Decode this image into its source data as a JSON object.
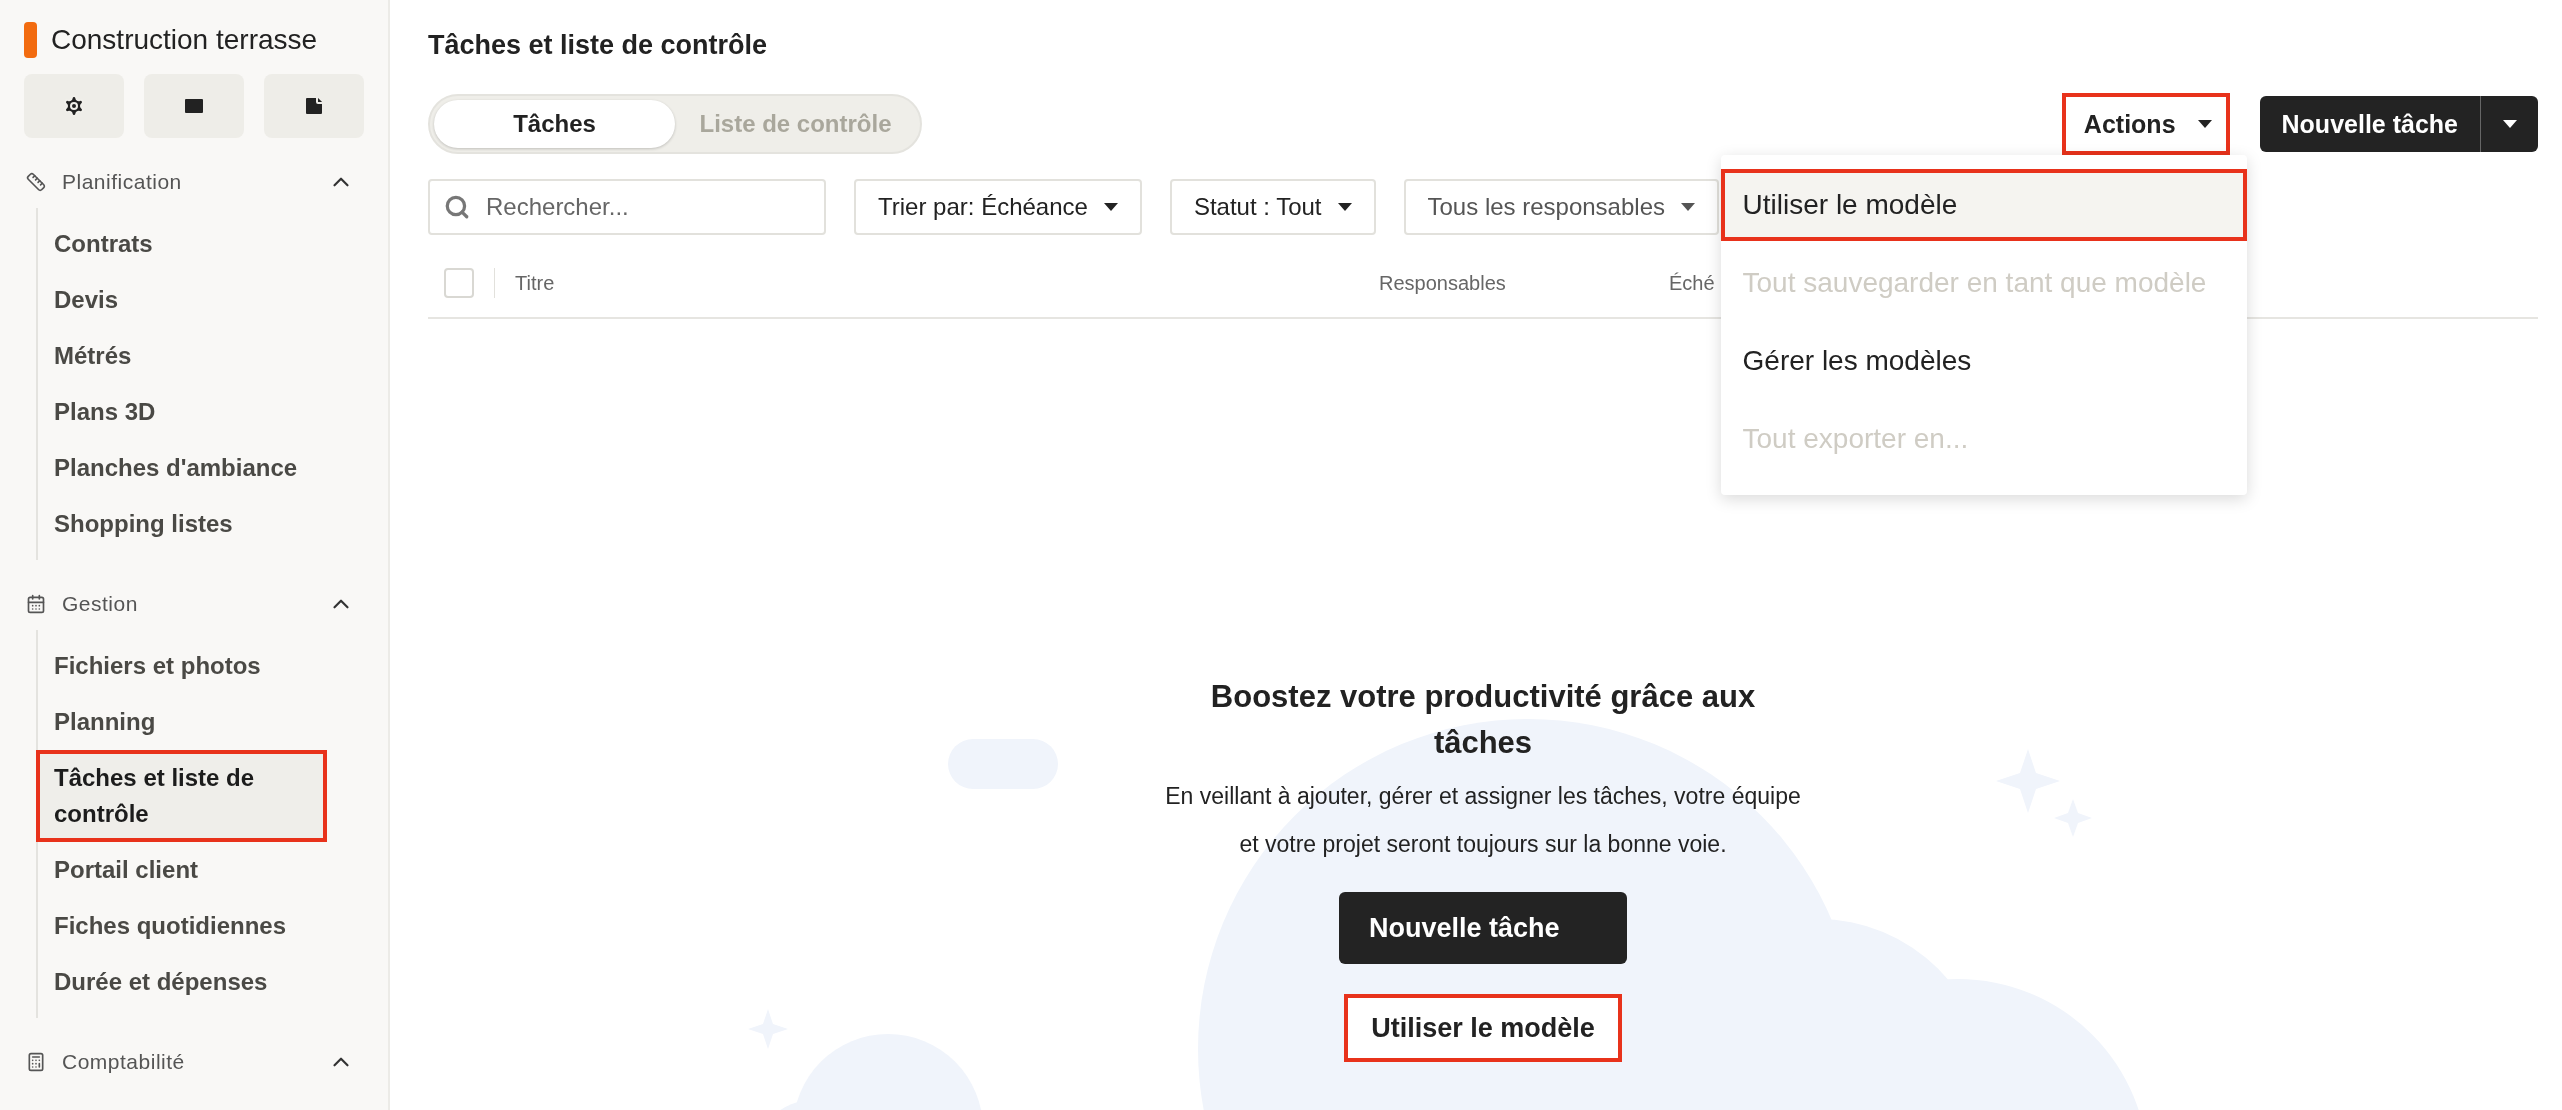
{
  "sidebar": {
    "project_title": "Construction terrasse",
    "sections": [
      {
        "label": "Planification",
        "kind": "planning",
        "expanded": true,
        "items": [
          {
            "label": "Contrats",
            "selected": false,
            "highlighted": false
          },
          {
            "label": "Devis",
            "selected": false,
            "highlighted": false
          },
          {
            "label": "Métrés",
            "selected": false,
            "highlighted": false
          },
          {
            "label": "Plans 3D",
            "selected": false,
            "highlighted": false
          },
          {
            "label": "Planches d'ambiance",
            "selected": false,
            "highlighted": false
          },
          {
            "label": "Shopping listes",
            "selected": false,
            "highlighted": false
          }
        ]
      },
      {
        "label": "Gestion",
        "kind": "calendar",
        "expanded": true,
        "items": [
          {
            "label": "Fichiers et photos",
            "selected": false,
            "highlighted": false
          },
          {
            "label": "Planning",
            "selected": false,
            "highlighted": false
          },
          {
            "label": "Tâches et liste de contrôle",
            "selected": true,
            "highlighted": true
          },
          {
            "label": "Portail client",
            "selected": false,
            "highlighted": false
          },
          {
            "label": "Fiches quotidiennes",
            "selected": false,
            "highlighted": false
          },
          {
            "label": "Durée et dépenses",
            "selected": false,
            "highlighted": false
          }
        ]
      },
      {
        "label": "Comptabilité",
        "kind": "calculator",
        "expanded": true
      }
    ]
  },
  "main": {
    "title": "Tâches et liste de contrôle",
    "tabs": [
      {
        "label": "Tâches",
        "selected": true
      },
      {
        "label": "Liste de contrôle",
        "selected": false
      }
    ],
    "actions_button": {
      "label": "Actions",
      "highlighted": true
    },
    "new_task_button": {
      "label": "Nouvelle tâche"
    },
    "actions_menu": [
      {
        "label": "Utiliser le modèle",
        "disabled": false,
        "highlighted": true
      },
      {
        "label": "Tout sauvegarder en tant que modèle",
        "disabled": true,
        "highlighted": false
      },
      {
        "label": "Gérer les modèles",
        "disabled": false,
        "highlighted": false
      },
      {
        "label": "Tout exporter en...",
        "disabled": true,
        "highlighted": false
      }
    ],
    "search": {
      "placeholder": "Rechercher..."
    },
    "filters": [
      "Trier par: Échéance",
      "Statut : Tout",
      "Tous les responsables"
    ],
    "table": {
      "select_all_checked": false,
      "columns": [
        "Titre",
        "Responsables",
        "Éché"
      ]
    },
    "empty_state": {
      "title": "Boostez votre productivité grâce aux tâches",
      "text": "En veillant à ajouter, gérer et assigner les tâches, votre équipe et votre projet seront toujours sur la bonne voie.",
      "primary_button": "Nouvelle tâche",
      "secondary_button": {
        "label": "Utiliser le modèle",
        "highlighted": true
      }
    }
  }
}
